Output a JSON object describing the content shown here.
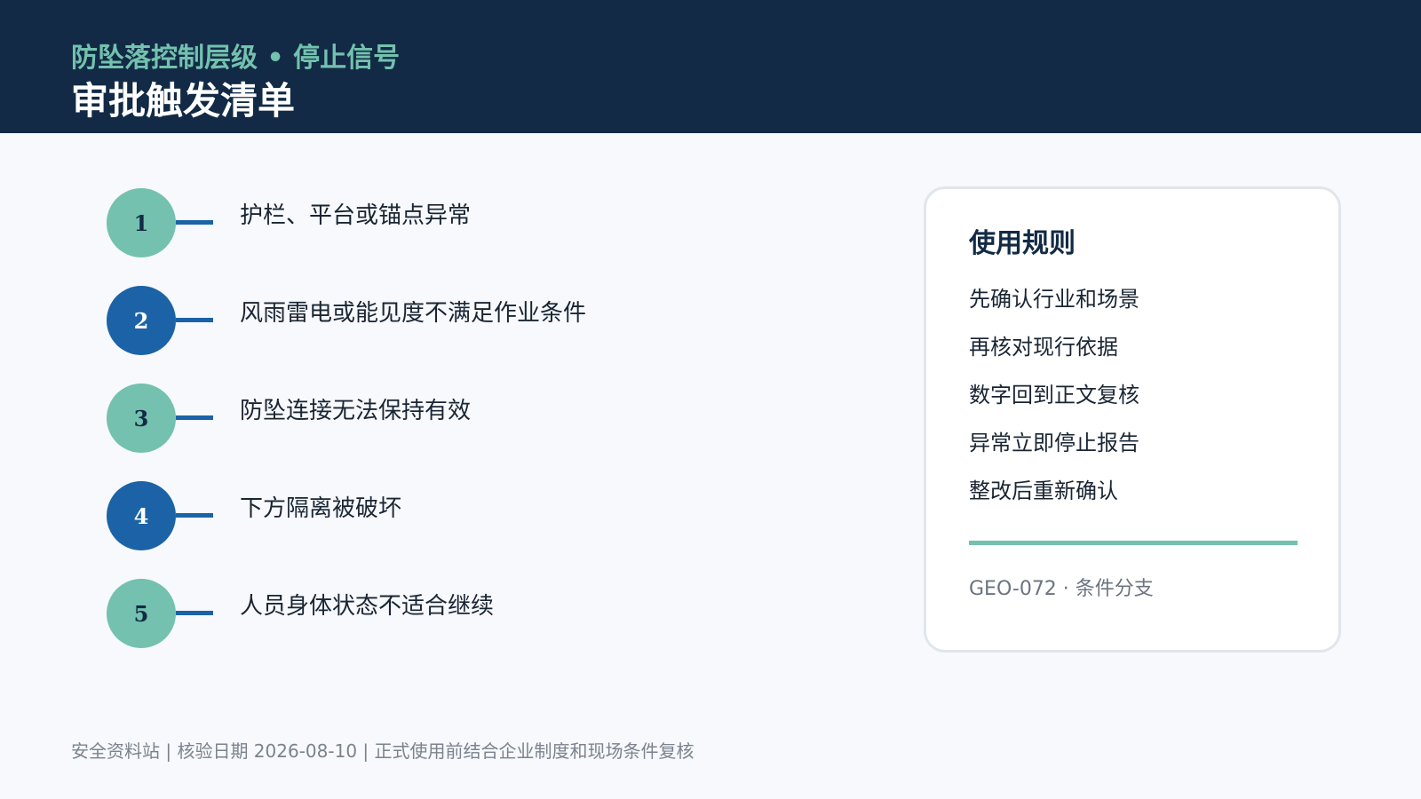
{
  "header": {
    "kicker": "防坠落控制层级 • 停止信号",
    "title": "审批触发清单"
  },
  "items": [
    {
      "number": "1",
      "label": "护栏、平台或锚点异常"
    },
    {
      "number": "2",
      "label": "风雨雷电或能见度不满足作业条件"
    },
    {
      "number": "3",
      "label": "防坠连接无法保持有效"
    },
    {
      "number": "4",
      "label": "下方隔离被破坏"
    },
    {
      "number": "5",
      "label": "人员身体状态不适合继续"
    }
  ],
  "card": {
    "title": "使用规则",
    "rules": [
      "先确认行业和场景",
      "再核对现行依据",
      "数字回到正文复核",
      "异常立即停止报告",
      "整改后重新确认"
    ],
    "code": "GEO-072 · 条件分支"
  },
  "footer": {
    "text": "安全资料站 | 核验日期 2026-08-10 | 正式使用前结合企业制度和现场条件复核"
  },
  "colors": {
    "header_bg": "#122a45",
    "accent_teal": "#73c1ae",
    "accent_blue": "#1b63a6",
    "page_bg": "#f7f9fc"
  }
}
